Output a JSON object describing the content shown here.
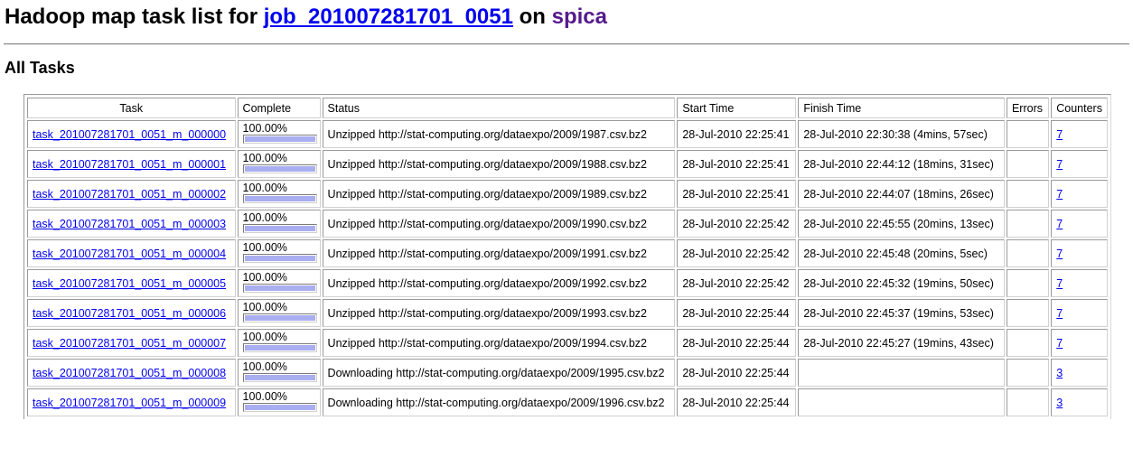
{
  "header": {
    "title_prefix": "Hadoop map task list for ",
    "job_link": "job_201007281701_0051",
    "title_middle": " on ",
    "host_link": "spica"
  },
  "section_title": "All Tasks",
  "colors": {
    "link": "#0000ee",
    "visited_link": "#551a8b",
    "progress_fill": "#a9aef0"
  },
  "table": {
    "columns": [
      "Task",
      "Complete",
      "Status",
      "Start Time",
      "Finish Time",
      "Errors",
      "Counters"
    ],
    "rows": [
      {
        "task": "task_201007281701_0051_m_000000",
        "complete": "100.00%",
        "progress": 1.0,
        "status": "Unzipped http://stat-computing.org/dataexpo/2009/1987.csv.bz2",
        "start": "28-Jul-2010 22:25:41",
        "finish": "28-Jul-2010 22:30:38 (4mins, 57sec)",
        "errors": "",
        "counters": "7"
      },
      {
        "task": "task_201007281701_0051_m_000001",
        "complete": "100.00%",
        "progress": 1.0,
        "status": "Unzipped http://stat-computing.org/dataexpo/2009/1988.csv.bz2",
        "start": "28-Jul-2010 22:25:41",
        "finish": "28-Jul-2010 22:44:12 (18mins, 31sec)",
        "errors": "",
        "counters": "7"
      },
      {
        "task": "task_201007281701_0051_m_000002",
        "complete": "100.00%",
        "progress": 1.0,
        "status": "Unzipped http://stat-computing.org/dataexpo/2009/1989.csv.bz2",
        "start": "28-Jul-2010 22:25:41",
        "finish": "28-Jul-2010 22:44:07 (18mins, 26sec)",
        "errors": "",
        "counters": "7"
      },
      {
        "task": "task_201007281701_0051_m_000003",
        "complete": "100.00%",
        "progress": 1.0,
        "status": "Unzipped http://stat-computing.org/dataexpo/2009/1990.csv.bz2",
        "start": "28-Jul-2010 22:25:42",
        "finish": "28-Jul-2010 22:45:55 (20mins, 13sec)",
        "errors": "",
        "counters": "7"
      },
      {
        "task": "task_201007281701_0051_m_000004",
        "complete": "100.00%",
        "progress": 1.0,
        "status": "Unzipped http://stat-computing.org/dataexpo/2009/1991.csv.bz2",
        "start": "28-Jul-2010 22:25:42",
        "finish": "28-Jul-2010 22:45:48 (20mins, 5sec)",
        "errors": "",
        "counters": "7"
      },
      {
        "task": "task_201007281701_0051_m_000005",
        "complete": "100.00%",
        "progress": 1.0,
        "status": "Unzipped http://stat-computing.org/dataexpo/2009/1992.csv.bz2",
        "start": "28-Jul-2010 22:25:42",
        "finish": "28-Jul-2010 22:45:32 (19mins, 50sec)",
        "errors": "",
        "counters": "7"
      },
      {
        "task": "task_201007281701_0051_m_000006",
        "complete": "100.00%",
        "progress": 1.0,
        "status": "Unzipped http://stat-computing.org/dataexpo/2009/1993.csv.bz2",
        "start": "28-Jul-2010 22:25:44",
        "finish": "28-Jul-2010 22:45:37 (19mins, 53sec)",
        "errors": "",
        "counters": "7"
      },
      {
        "task": "task_201007281701_0051_m_000007",
        "complete": "100.00%",
        "progress": 1.0,
        "status": "Unzipped http://stat-computing.org/dataexpo/2009/1994.csv.bz2",
        "start": "28-Jul-2010 22:25:44",
        "finish": "28-Jul-2010 22:45:27 (19mins, 43sec)",
        "errors": "",
        "counters": "7"
      },
      {
        "task": "task_201007281701_0051_m_000008",
        "complete": "100.00%",
        "progress": 1.0,
        "status": "Downloading http://stat-computing.org/dataexpo/2009/1995.csv.bz2",
        "start": "28-Jul-2010 22:25:44",
        "finish": "",
        "errors": "",
        "counters": "3"
      },
      {
        "task": "task_201007281701_0051_m_000009",
        "complete": "100.00%",
        "progress": 1.0,
        "status": "Downloading http://stat-computing.org/dataexpo/2009/1996.csv.bz2",
        "start": "28-Jul-2010 22:25:44",
        "finish": "",
        "errors": "",
        "counters": "3"
      }
    ]
  }
}
